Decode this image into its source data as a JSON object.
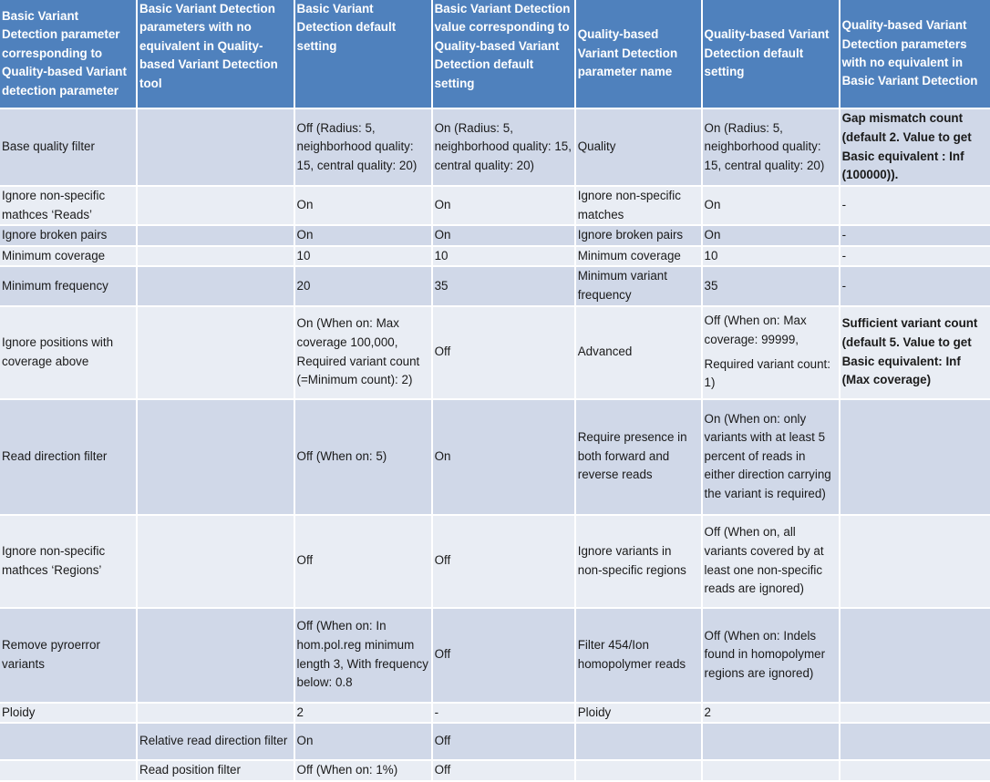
{
  "table": {
    "headers": [
      "Basic Variant Detection parameter corresponding to Quality-based Variant detection parameter",
      "Basic Variant Detection parameters with no equivalent in Quality-based Variant Detection tool",
      "Basic Variant Detection  default setting",
      "Basic Variant Detection value corresponding to Quality-based Variant Detection default setting",
      "Quality-based Variant Detection parameter name",
      "Quality-based Variant Detection default setting",
      "Quality-based Variant Detection parameters with no equivalent in Basic Variant Detection"
    ],
    "rows": [
      {
        "basic_param": "Base quality filter",
        "basic_no_equiv": "",
        "basic_default": "Off (Radius: 5, neighborhood quality: 15, central quality: 20)",
        "basic_value_for_quality": "On (Radius: 5, neighborhood quality: 15, central quality: 20)",
        "quality_param": "Quality",
        "quality_default": "On (Radius: 5, neighborhood quality: 15, central quality: 20)",
        "quality_no_equiv": "Gap mismatch count (default 2. Value to get Basic equivalent : Inf (100000))."
      },
      {
        "basic_param": "Ignore non-specific mathces ‘Reads’",
        "basic_no_equiv": "",
        "basic_default": "On",
        "basic_value_for_quality": "On",
        "quality_param": "Ignore non-specific matches",
        "quality_default": "On",
        "quality_no_equiv": "-"
      },
      {
        "basic_param": "Ignore broken pairs",
        "basic_no_equiv": "",
        "basic_default": "On",
        "basic_value_for_quality": "On",
        "quality_param": "Ignore broken pairs",
        "quality_default": "On",
        "quality_no_equiv": "-"
      },
      {
        "basic_param": "Minimum coverage",
        "basic_no_equiv": "",
        "basic_default": "10",
        "basic_value_for_quality": "10",
        "quality_param": "Minimum coverage",
        "quality_default": "10",
        "quality_no_equiv": "-"
      },
      {
        "basic_param": "Minimum frequency",
        "basic_no_equiv": "",
        "basic_default": "20",
        "basic_value_for_quality": "35",
        "quality_param": "Minimum variant frequency",
        "quality_default": "35",
        "quality_no_equiv": "-"
      },
      {
        "basic_param": "Ignore positions with coverage above",
        "basic_no_equiv": "",
        "basic_default": "On (When on: Max coverage 100,000, Required variant count (=Minimum count): 2)",
        "basic_value_for_quality": "Off",
        "quality_param": "Advanced",
        "quality_default": "Off (When on: Max coverage: 99999,",
        "quality_default_2": "Required variant count: 1)",
        "quality_no_equiv": "Sufficient variant count (default 5. Value to get Basic equivalent: Inf (Max coverage)"
      },
      {
        "basic_param": "Read direction filter",
        "basic_no_equiv": "",
        "basic_default": "Off (When on: 5)",
        "basic_value_for_quality": "On",
        "quality_param": "Require presence in both forward and reverse reads",
        "quality_default": "On (When on: only variants with at least 5 percent of reads in either direction carrying the variant is required)",
        "quality_no_equiv": ""
      },
      {
        "basic_param": "Ignore non-specific mathces ‘Regions’",
        "basic_no_equiv": "",
        "basic_default": "Off",
        "basic_value_for_quality": "Off",
        "quality_param": "Ignore variants in non-specific regions",
        "quality_default": "Off (When on, all variants covered by at least one non-specific reads are ignored)",
        "quality_no_equiv": ""
      },
      {
        "basic_param": "Remove pyroerror variants",
        "basic_no_equiv": "",
        "basic_default": "Off (When on: In hom.pol.reg minimum length 3, With frequency below: 0.8",
        "basic_value_for_quality": "Off",
        "quality_param": "Filter 454/Ion homopolymer reads",
        "quality_default": "Off (When on: Indels found in homopolymer regions are ignored)",
        "quality_no_equiv": ""
      },
      {
        "basic_param": "Ploidy",
        "basic_no_equiv": "",
        "basic_default": "2",
        "basic_value_for_quality": "-",
        "quality_param": "Ploidy",
        "quality_default": "2",
        "quality_no_equiv": ""
      },
      {
        "basic_param": "",
        "basic_no_equiv": "Relative read direction filter",
        "basic_default": "On",
        "basic_value_for_quality": "Off",
        "quality_param": "",
        "quality_default": "",
        "quality_no_equiv": ""
      },
      {
        "basic_param": "",
        "basic_no_equiv": "Read position filter",
        "basic_default": "Off (When on: 1%)",
        "basic_value_for_quality": "Off",
        "quality_param": "",
        "quality_default": "",
        "quality_no_equiv": ""
      }
    ]
  },
  "colors": {
    "header_bg": "#4f81bd",
    "row_dark": "#d0d8e8",
    "row_light": "#e9edf4"
  }
}
